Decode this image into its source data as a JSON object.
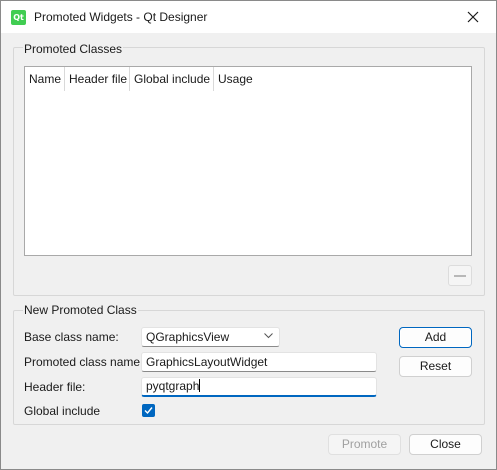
{
  "window": {
    "title": "Promoted Widgets - Qt Designer",
    "app_icon_text": "Qt"
  },
  "promoted_classes": {
    "group_title": "Promoted Classes",
    "columns": [
      "Name",
      "Header file",
      "Global include",
      "Usage"
    ],
    "rows": []
  },
  "new_promoted_class": {
    "group_title": "New Promoted Class",
    "base_class_label": "Base class name:",
    "base_class_value": "QGraphicsView",
    "promoted_class_label": "Promoted class name:",
    "promoted_class_value": "GraphicsLayoutWidget",
    "header_file_label": "Header file:",
    "header_file_value": "pyqtgraph",
    "global_include_label": "Global include",
    "global_include_checked": true,
    "add_label": "Add",
    "reset_label": "Reset"
  },
  "footer": {
    "promote_label": "Promote",
    "close_label": "Close"
  },
  "colors": {
    "accent": "#0067c0",
    "qt_green": "#41cd52"
  }
}
